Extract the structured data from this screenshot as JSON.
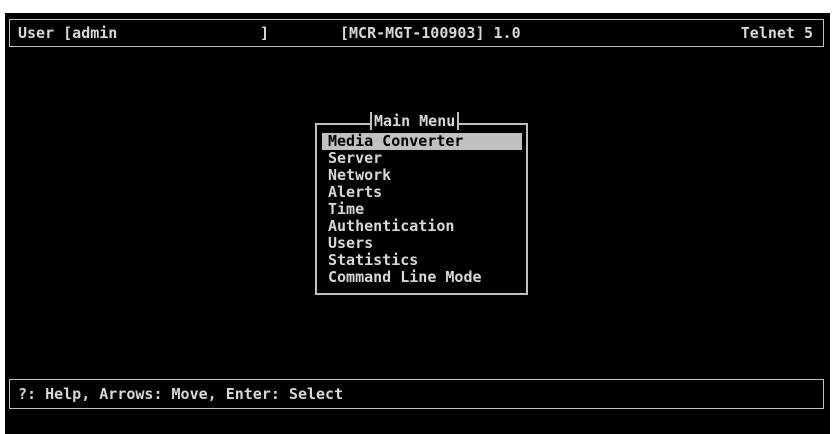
{
  "header": {
    "user_label": "User [admin",
    "user_close": "]",
    "title": "[MCR-MGT-100903] 1.0",
    "session": "Telnet 5"
  },
  "menu": {
    "title": "Main Menu",
    "selected_index": 0,
    "items": [
      {
        "label": "Media Converter"
      },
      {
        "label": "Server"
      },
      {
        "label": "Network"
      },
      {
        "label": "Alerts"
      },
      {
        "label": "Time"
      },
      {
        "label": "Authentication"
      },
      {
        "label": "Users"
      },
      {
        "label": "Statistics"
      },
      {
        "label": "Command Line Mode"
      }
    ]
  },
  "footer": {
    "help_text": "?: Help, Arrows: Move, Enter: Select"
  },
  "colors": {
    "background": "#000000",
    "text": "#d8d8d8",
    "highlight": "#c0c0c0",
    "highlight_text": "#000000"
  }
}
